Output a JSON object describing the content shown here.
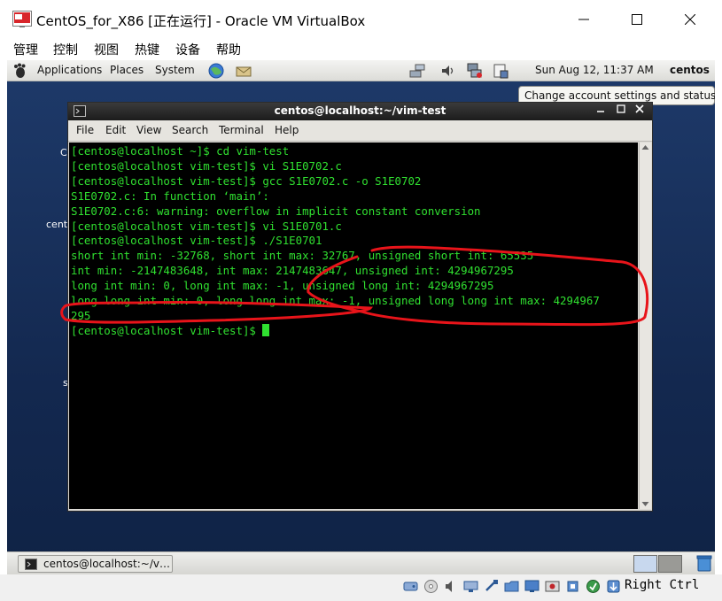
{
  "vbox": {
    "title": "CentOS_for_X86 [正在运行] - Oracle VM VirtualBox",
    "menu": [
      "管理",
      "控制",
      "视图",
      "热键",
      "设备",
      "帮助"
    ],
    "host_key": "Right Ctrl"
  },
  "gnome": {
    "panel": {
      "applications": "Applications",
      "places": "Places",
      "system": "System",
      "clock": "Sun Aug 12, 11:37 AM",
      "user": "centos"
    },
    "tooltip": "Change account settings and status",
    "taskbar": {
      "terminal_task": "centos@localhost:~/v…"
    }
  },
  "terminal": {
    "title": "centos@localhost:~/vim-test",
    "menu": [
      "File",
      "Edit",
      "View",
      "Search",
      "Terminal",
      "Help"
    ],
    "lines": [
      "[centos@localhost ~]$ cd vim-test",
      "[centos@localhost vim-test]$ vi S1E0702.c",
      "[centos@localhost vim-test]$ gcc S1E0702.c -o S1E0702",
      "S1E0702.c: In function ‘main’:",
      "S1E0702.c:6: warning: overflow in implicit constant conversion",
      "[centos@localhost vim-test]$ vi S1E0701.c",
      "[centos@localhost vim-test]$ ./S1E0701",
      "short int min: -32768, short int max: 32767, unsigned short int: 65535",
      "int min: -2147483648, int max: 2147483647, unsigned int: 4294967295",
      "long int min: 0, long int max: -1, unsigned long int: 4294967295",
      "long long int min: 0, long long int max: -1, unsigned long long int max: 4294967",
      "295"
    ],
    "prompt": "[centos@localhost vim-test]$ "
  },
  "colors": {
    "terminal_fg": "#30e030",
    "annotation": "#e8141a"
  }
}
